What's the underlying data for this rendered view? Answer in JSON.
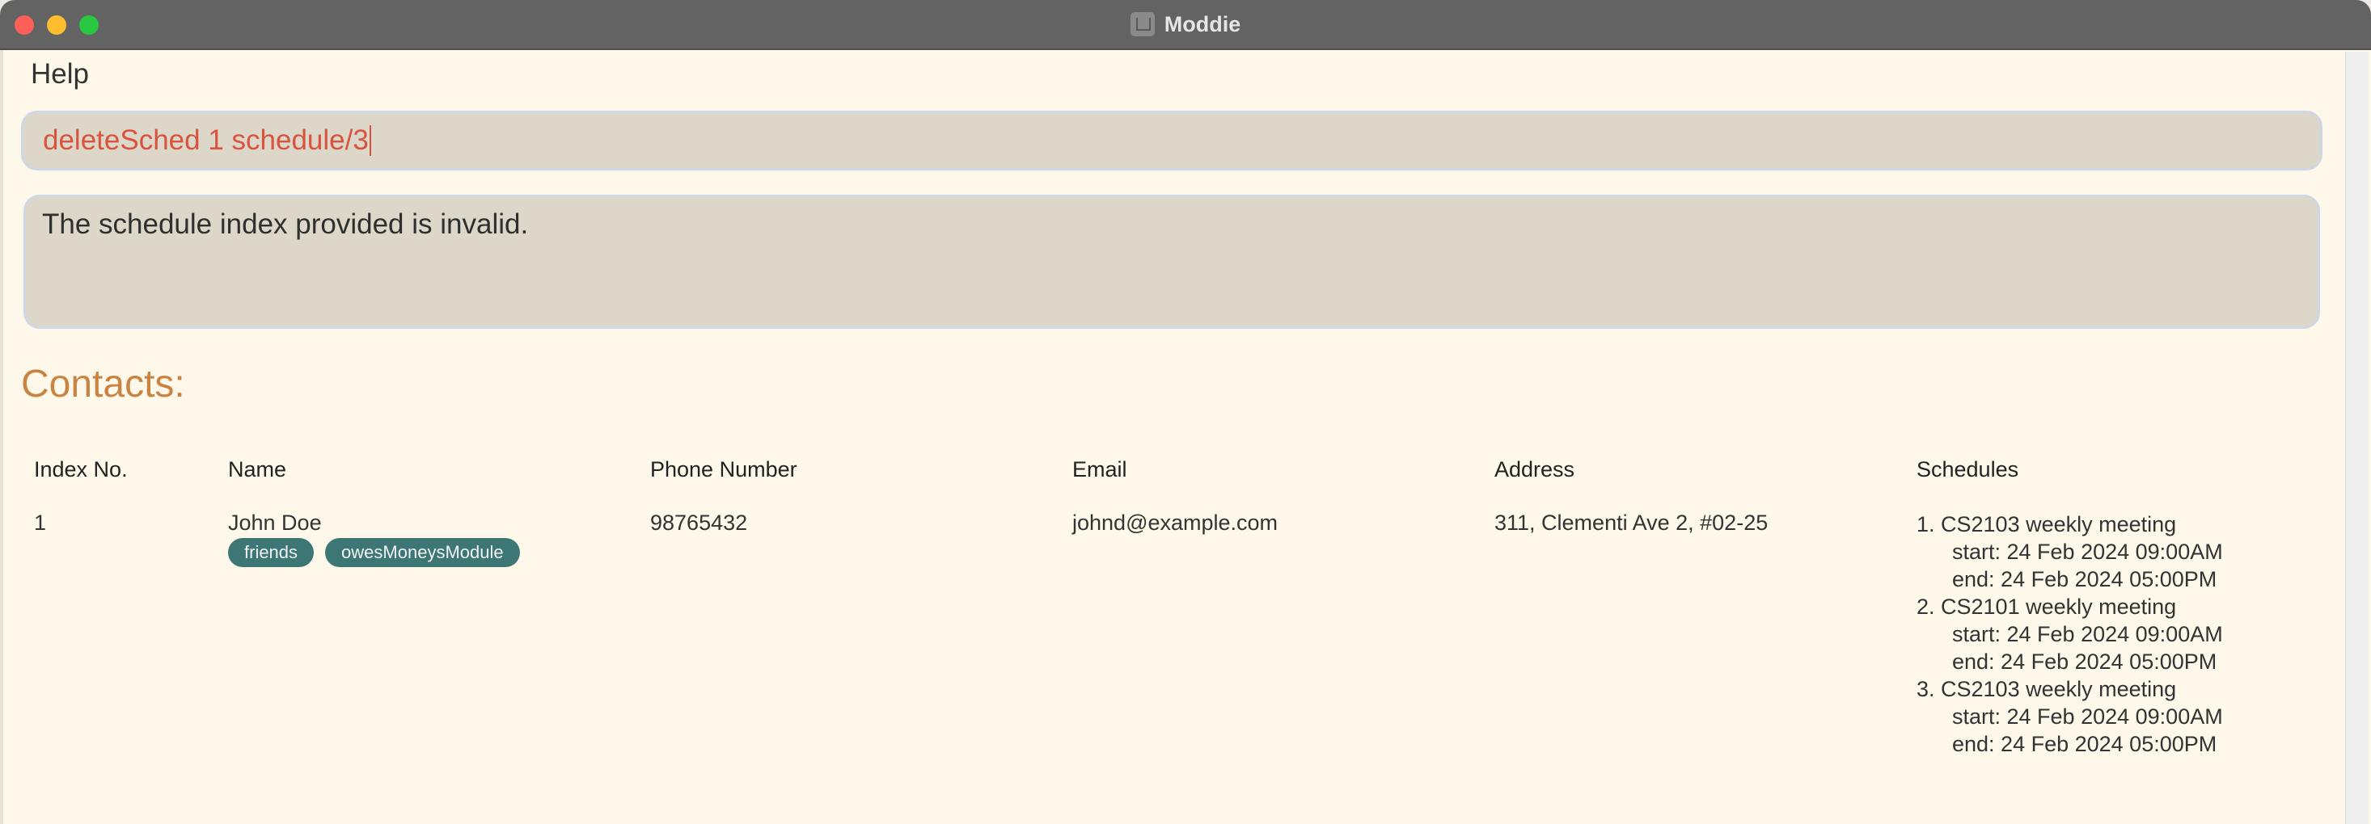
{
  "window": {
    "title": "Moddie",
    "app_icon": "moddie-app-icon"
  },
  "menu": {
    "help": "Help"
  },
  "command": {
    "value": "deleteSched 1 schedule/3"
  },
  "result": {
    "text": "The schedule index provided is invalid."
  },
  "contacts": {
    "title": "Contacts:",
    "headers": [
      "Index No.",
      "Name",
      "Phone Number",
      "Email",
      "Address",
      "Schedules"
    ],
    "rows": [
      {
        "index": "1",
        "name": "John Doe",
        "tags": [
          "friends",
          "owesMoneysModule"
        ],
        "phone": "98765432",
        "email": "johnd@example.com",
        "address": "311, Clementi Ave 2, #02-25",
        "schedules": [
          {
            "title": "1. CS2103 weekly meeting",
            "start": "start: 24 Feb 2024 09:00AM",
            "end": "end: 24 Feb 2024 05:00PM"
          },
          {
            "title": "2. CS2101 weekly meeting",
            "start": "start: 24 Feb 2024 09:00AM",
            "end": "end: 24 Feb 2024 05:00PM"
          },
          {
            "title": "3. CS2103 weekly meeting",
            "start": "start: 24 Feb 2024 09:00AM",
            "end": "end: 24 Feb 2024 05:00PM"
          }
        ]
      }
    ]
  },
  "colors": {
    "background": "#fdf8ea",
    "command_text": "#d9533e",
    "contacts_title": "#c98443",
    "tag": "#3c7775"
  }
}
